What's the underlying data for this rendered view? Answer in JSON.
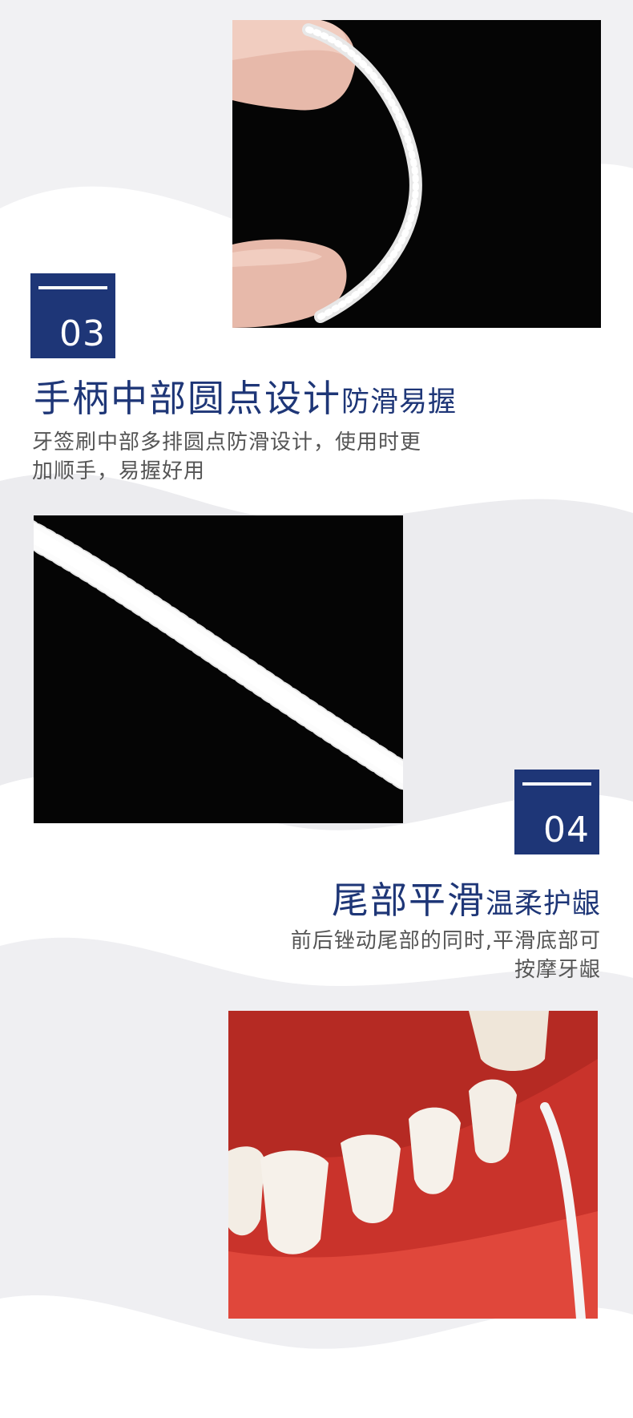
{
  "colors": {
    "brand_blue": "#1e3677",
    "text_gray": "#555555",
    "wave_gray": "#ececef",
    "photo_black": "#000000",
    "gum_red": "#d83a2f"
  },
  "sections": [
    {
      "number": "03",
      "title_main": "手柄中部圆点设计",
      "title_sub": "防滑易握",
      "desc_lines": [
        "牙签刷中部多排圆点防滑设计，使用时更",
        "加顺手，易握好用"
      ]
    },
    {
      "number": "04",
      "title_main": "尾部平滑",
      "title_sub": "温柔护龈",
      "desc_lines": [
        "前后锉动尾部的同时,平滑底部可",
        "按摩牙龈"
      ]
    }
  ],
  "images": {
    "top": "curved-dotted-toothpick-held-by-fingers-photo",
    "middle": "dotted-toothpick-handle-closeup-photo",
    "bottom": "toothpick-tip-against-teeth-and-gums-photo"
  }
}
